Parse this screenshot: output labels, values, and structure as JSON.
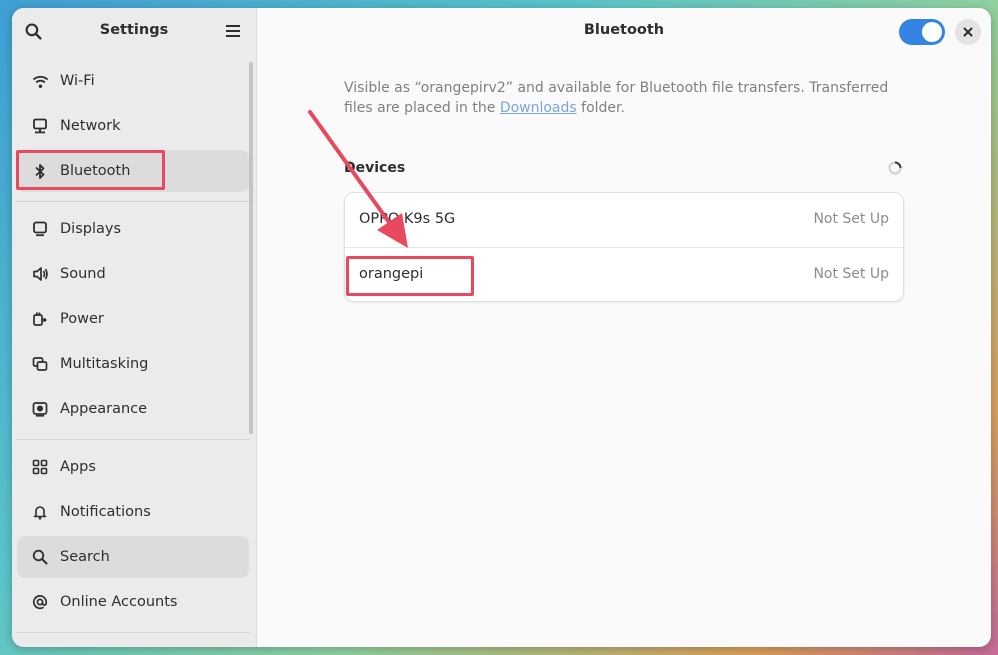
{
  "sidebar": {
    "title": "Settings",
    "search_icon": "search-icon",
    "menu_icon": "hamburger-menu-icon",
    "items": [
      {
        "label": "Wi-Fi",
        "icon": "wifi-icon"
      },
      {
        "label": "Network",
        "icon": "network-icon"
      },
      {
        "label": "Bluetooth",
        "icon": "bluetooth-icon",
        "active": true
      },
      {
        "label": "Displays",
        "icon": "display-icon"
      },
      {
        "label": "Sound",
        "icon": "speaker-icon"
      },
      {
        "label": "Power",
        "icon": "power-plug-icon"
      },
      {
        "label": "Multitasking",
        "icon": "multitasking-icon"
      },
      {
        "label": "Appearance",
        "icon": "appearance-icon"
      },
      {
        "label": "Apps",
        "icon": "apps-grid-icon"
      },
      {
        "label": "Notifications",
        "icon": "bell-icon"
      },
      {
        "label": "Search",
        "icon": "search-icon",
        "active": true
      },
      {
        "label": "Online Accounts",
        "icon": "at-sign-icon"
      }
    ]
  },
  "main": {
    "title": "Bluetooth",
    "toggle_on": true,
    "description_before": "Visible as “orangepirv2” and available for Bluetooth file transfers. Transferred files are placed in the ",
    "description_link": "Downloads",
    "description_after": " folder.",
    "devices_title": "Devices",
    "devices": [
      {
        "name": "OPPO K9s 5G",
        "status": "Not Set Up"
      },
      {
        "name": "orangepi",
        "status": "Not Set Up"
      }
    ]
  },
  "colors": {
    "accent": "#3584e4",
    "highlight": "#e8495e"
  }
}
